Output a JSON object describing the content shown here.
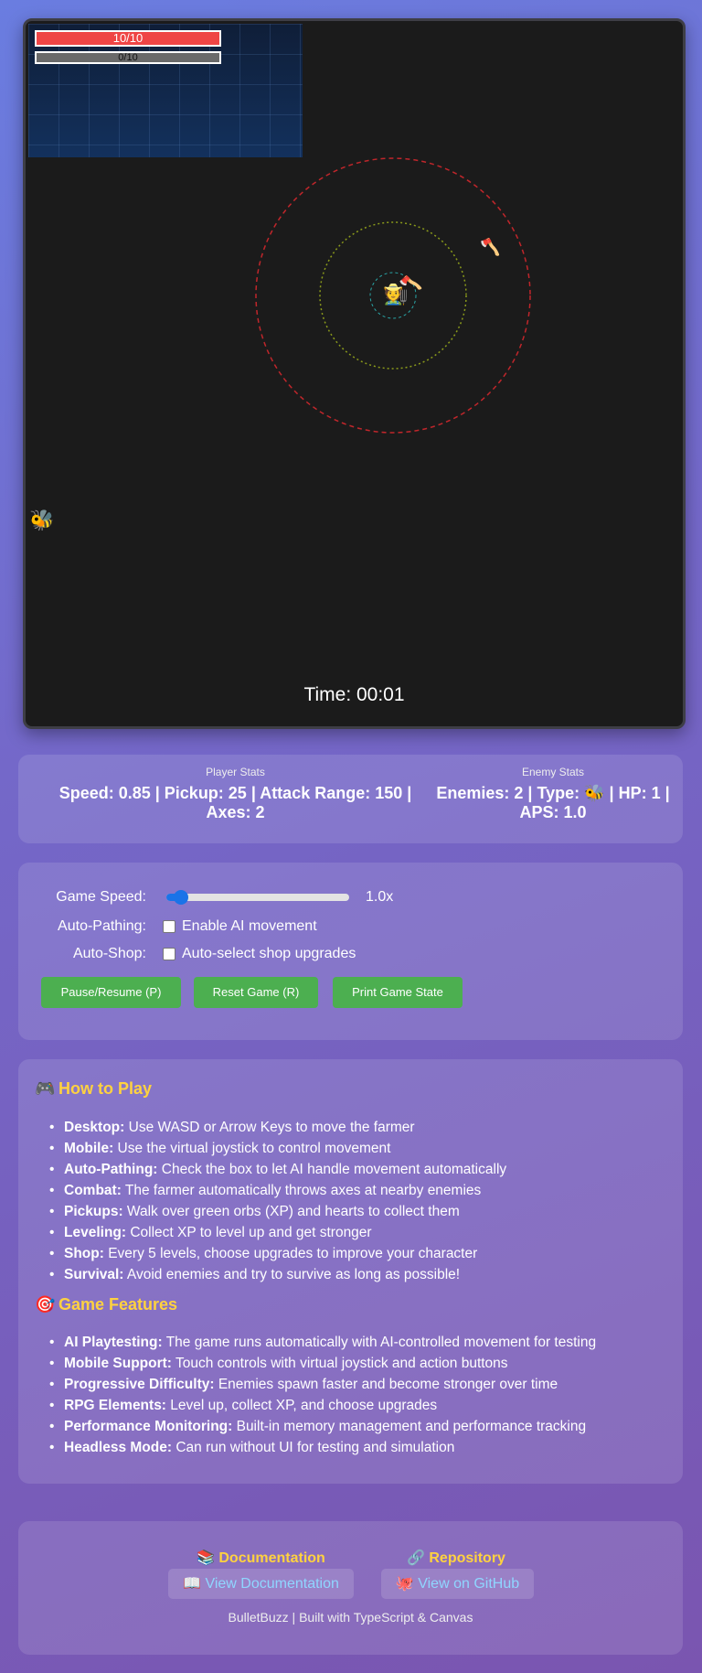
{
  "game": {
    "hp": {
      "text": "10/10",
      "fraction": 1.0
    },
    "xp": {
      "text": "0/10",
      "fraction": 0.0
    },
    "player_emoji": "🧑‍🌾",
    "axe_emoji": "🪓",
    "enemy_emoji": "🐝",
    "timer": "Time: 00:01",
    "colors": {
      "attack_range": "#c0262b",
      "pickup_range": "#8a9a1b",
      "inner_range": "#2aa5a6"
    }
  },
  "stats": {
    "player_title": "Player Stats",
    "player_value": "Speed: 0.85 | Pickup: 25 | Attack Range: 150 | Axes: 2",
    "enemy_title": "Enemy Stats",
    "enemy_value": "Enemies: 2 | Type: 🐝 | HP: 1 | APS: 1.0"
  },
  "controls": {
    "game_speed_label": "Game Speed:",
    "game_speed_value": "1.0x",
    "game_speed_fraction": 0.08,
    "auto_pathing_label": "Auto-Pathing:",
    "auto_pathing_text": "Enable AI movement",
    "auto_shop_label": "Auto-Shop:",
    "auto_shop_text": "Auto-select shop upgrades",
    "buttons": [
      "Pause/Resume (P)",
      "Reset Game (R)",
      "Print Game State"
    ],
    "button_color": "#4caf50"
  },
  "howto": {
    "title_icon": "🎮",
    "title": "How to Play",
    "items": [
      {
        "bold": "Desktop:",
        "text": " Use WASD or Arrow Keys to move the farmer"
      },
      {
        "bold": "Mobile:",
        "text": " Use the virtual joystick to control movement"
      },
      {
        "bold": "Auto-Pathing:",
        "text": " Check the box to let AI handle movement automatically"
      },
      {
        "bold": "Combat:",
        "text": " The farmer automatically throws axes at nearby enemies"
      },
      {
        "bold": "Pickups:",
        "text": " Walk over green orbs (XP) and hearts to collect them"
      },
      {
        "bold": "Leveling:",
        "text": " Collect XP to level up and get stronger"
      },
      {
        "bold": "Shop:",
        "text": " Every 5 levels, choose upgrades to improve your character"
      },
      {
        "bold": "Survival:",
        "text": " Avoid enemies and try to survive as long as possible!"
      }
    ],
    "features_icon": "🎯",
    "features_title": "Game Features",
    "features": [
      {
        "bold": "AI Playtesting:",
        "text": " The game runs automatically with AI-controlled movement for testing"
      },
      {
        "bold": "Mobile Support:",
        "text": " Touch controls with virtual joystick and action buttons"
      },
      {
        "bold": "Progressive Difficulty:",
        "text": " Enemies spawn faster and become stronger over time"
      },
      {
        "bold": "RPG Elements:",
        "text": " Level up, collect XP, and choose upgrades"
      },
      {
        "bold": "Performance Monitoring:",
        "text": " Built-in memory management and performance tracking"
      },
      {
        "bold": "Headless Mode:",
        "text": " Can run without UI for testing and simulation"
      }
    ]
  },
  "footer": {
    "docs_head": "📚 Documentation",
    "repo_head": "🔗 Repository",
    "docs_link": "📖 View Documentation",
    "repo_link": "🐙 View on GitHub",
    "credit": "BulletBuzz | Built with TypeScript & Canvas"
  }
}
